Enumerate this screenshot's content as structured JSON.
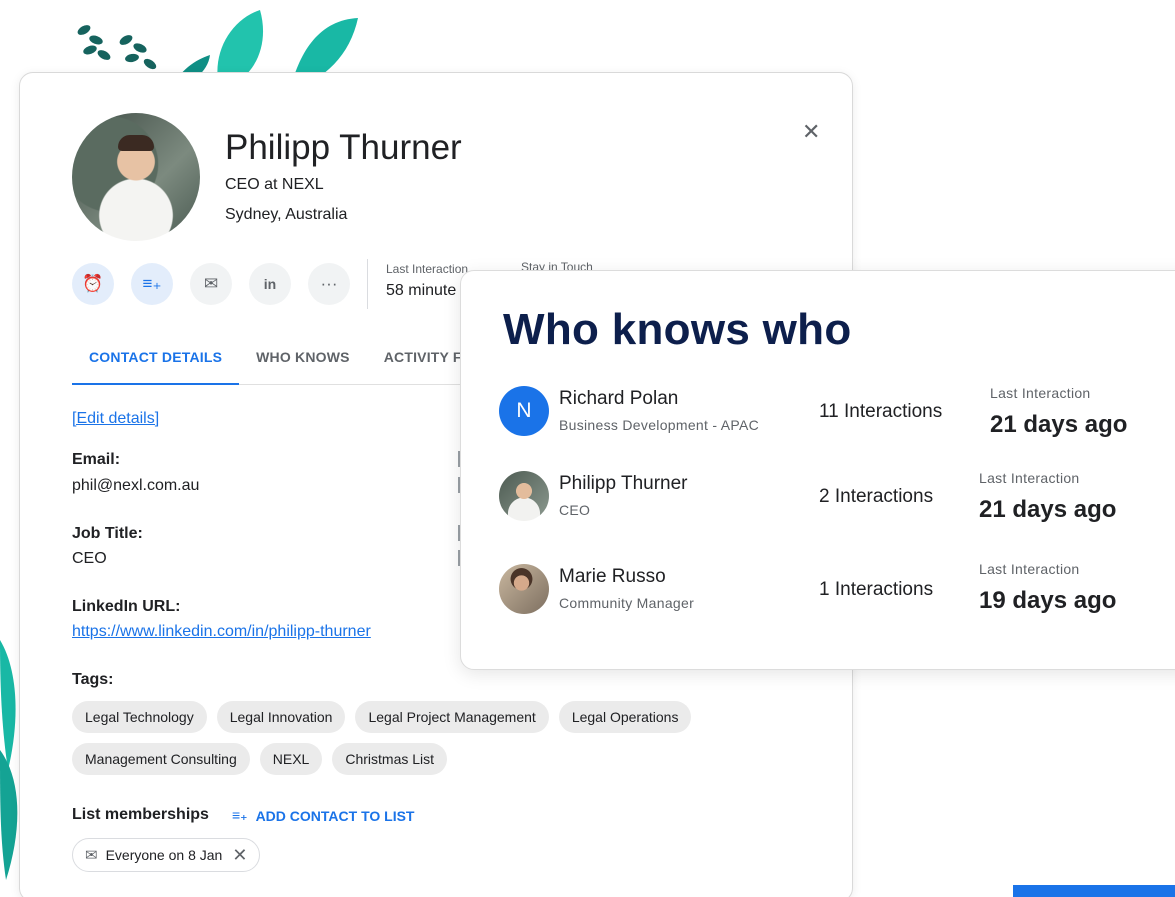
{
  "profile": {
    "name": "Philipp Thurner",
    "title": "CEO at NEXL",
    "location": "Sydney, Australia",
    "close_icon": "close-icon",
    "actions": [
      {
        "icon": "alarm-add-icon",
        "glyph": "⏰"
      },
      {
        "icon": "playlist-add-icon",
        "glyph": "≡₊"
      },
      {
        "icon": "mail-icon",
        "glyph": "✉"
      },
      {
        "icon": "linkedin-icon",
        "glyph": "in"
      },
      {
        "icon": "more-icon",
        "glyph": "···"
      }
    ],
    "last_interaction_label": "Last Interaction",
    "last_interaction_value": "58 minute",
    "stay_in_touch_label": "Stay in Touch"
  },
  "tabs": [
    {
      "label": "CONTACT DETAILS",
      "active": true
    },
    {
      "label": "WHO KNOWS",
      "active": false
    },
    {
      "label": "ACTIVITY F",
      "active": false
    }
  ],
  "details": {
    "edit_link": "[Edit details]",
    "email_label": "Email:",
    "email_value": "phil@nexl.com.au",
    "job_label": "Job Title:",
    "job_value": "CEO",
    "linkedin_label": "LinkedIn URL:",
    "linkedin_value": "https://www.linkedin.com/in/philipp-thurner",
    "tags_label": "Tags:",
    "tags": [
      "Legal Technology",
      "Legal Innovation",
      "Legal Project Management",
      "Legal Operations",
      "Management Consulting",
      "NEXL",
      "Christmas List"
    ],
    "list_memberships_label": "List memberships",
    "add_to_list_label": "ADD CONTACT TO LIST",
    "list_chip": "Everyone on 8 Jan"
  },
  "who_knows": {
    "title": "Who knows who",
    "people": [
      {
        "initial": "N",
        "name": "Richard Polan",
        "role": "Business Development - APAC",
        "interactions": "11 Interactions",
        "li_label": "Last Interaction",
        "li_value": "21 days ago"
      },
      {
        "initial": "",
        "name": "Philipp Thurner",
        "role": "CEO",
        "interactions": "2 Interactions",
        "li_label": "Last Interaction",
        "li_value": "21 days ago"
      },
      {
        "initial": "",
        "name": "Marie Russo",
        "role": "Community Manager",
        "interactions": "1 Interactions",
        "li_label": "Last Interaction",
        "li_value": "19 days ago"
      }
    ]
  },
  "colors": {
    "accent": "#1a73e8",
    "title": "#0d1f4c",
    "leaf": "#17b9a6"
  }
}
